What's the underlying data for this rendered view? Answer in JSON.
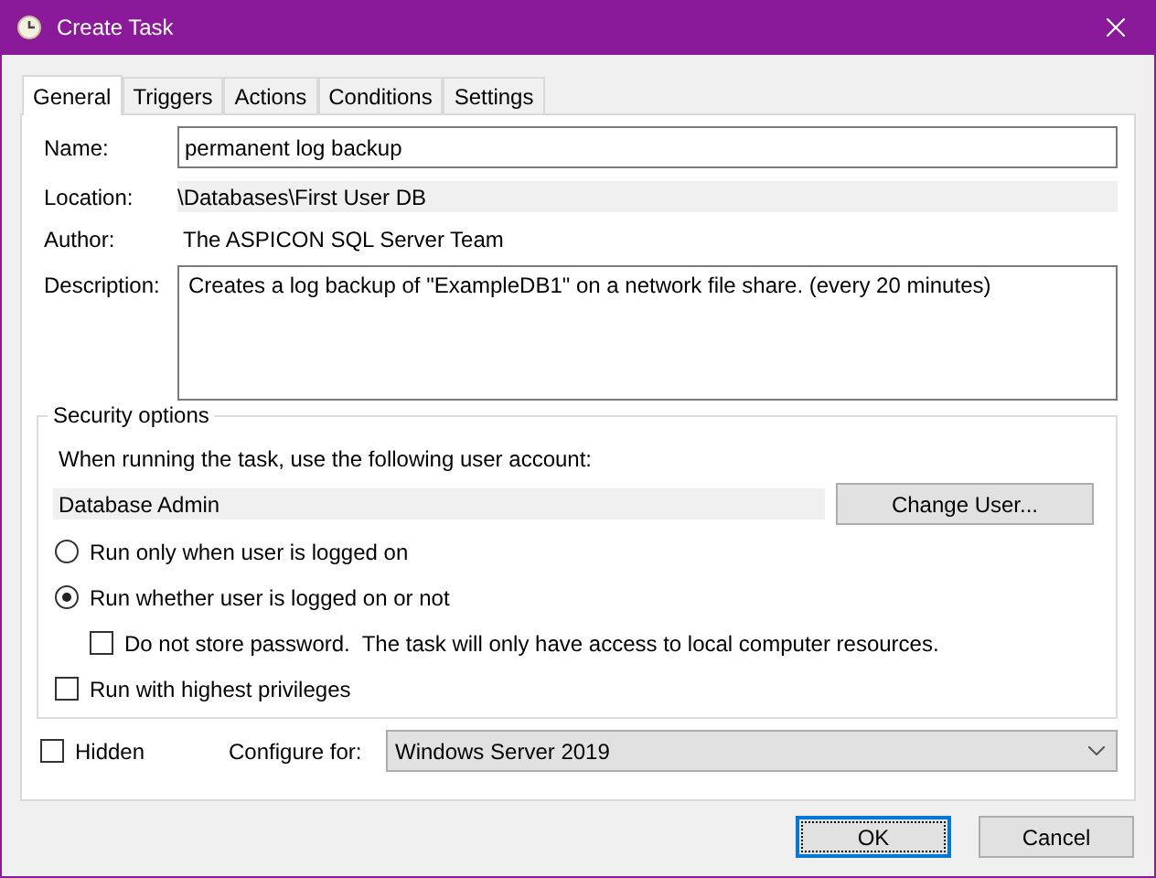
{
  "window": {
    "title": "Create Task"
  },
  "tabs": [
    {
      "label": "General",
      "selected": true
    },
    {
      "label": "Triggers",
      "selected": false
    },
    {
      "label": "Actions",
      "selected": false
    },
    {
      "label": "Conditions",
      "selected": false
    },
    {
      "label": "Settings",
      "selected": false
    }
  ],
  "general": {
    "name": {
      "label": "Name:",
      "value": "permanent log backup"
    },
    "location": {
      "label": "Location:",
      "value": "\\Databases\\First User DB"
    },
    "author": {
      "label": "Author:",
      "value": "The ASPICON SQL Server Team"
    },
    "description": {
      "label": "Description:",
      "value": "Creates a log backup of \"ExampleDB1\" on a network file share. (every 20 minutes)"
    }
  },
  "security": {
    "title": "Security options",
    "account_prompt": "When running the task, use the following user account:",
    "account": "Database Admin",
    "change_user_button": "Change User...",
    "options": [
      {
        "kind": "radio",
        "label": "Run only when user is logged on",
        "selected": false
      },
      {
        "kind": "radio",
        "label": "Run whether user is logged on or not",
        "selected": true,
        "children": [
          {
            "kind": "checkbox",
            "label": "Do not store password.  The task will only have access to local computer resources.",
            "checked": false
          }
        ]
      },
      {
        "kind": "checkbox",
        "label": "Run with highest privileges",
        "checked": false
      }
    ]
  },
  "hidden": {
    "label": "Hidden",
    "checked": false
  },
  "configure_for": {
    "label": "Configure for:",
    "value": "Windows Server 2019"
  },
  "buttons": [
    {
      "label": "OK",
      "default": true
    },
    {
      "label": "Cancel",
      "default": false
    }
  ]
}
